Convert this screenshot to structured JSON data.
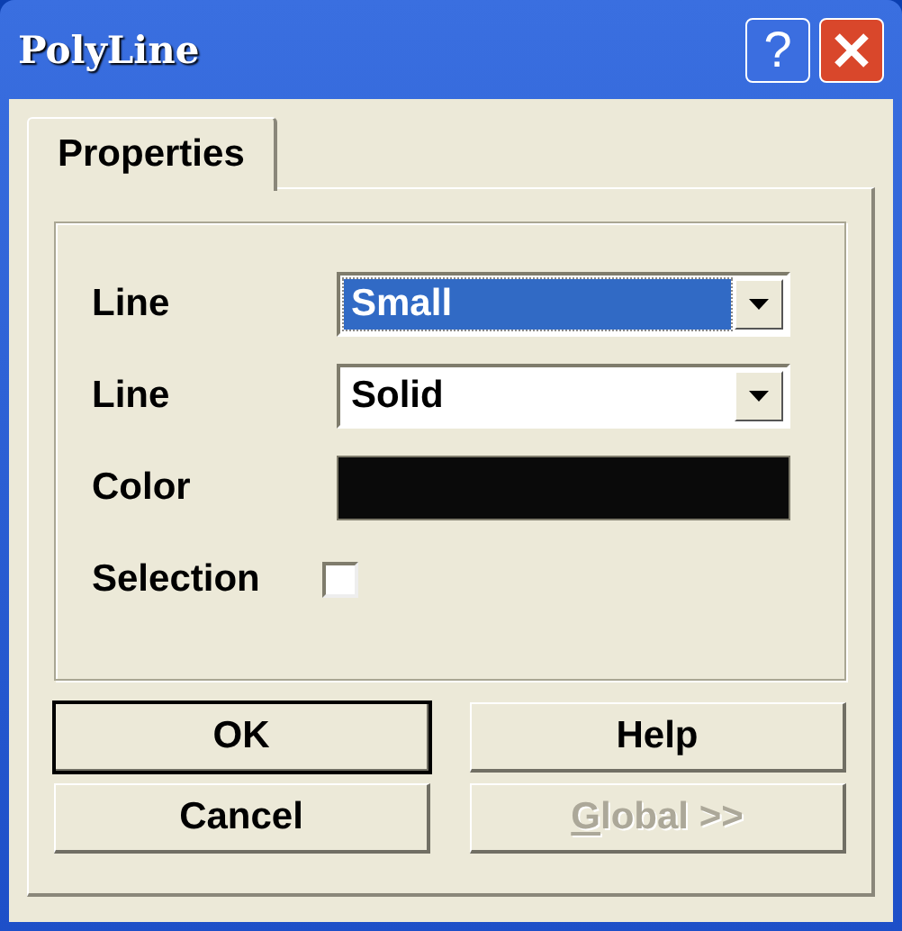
{
  "window": {
    "title": "PolyLine"
  },
  "title_buttons": [
    {
      "kind": "help",
      "label": "?"
    },
    {
      "kind": "close"
    }
  ],
  "tabs": [
    {
      "label": "Properties",
      "selected": true
    }
  ],
  "fields": [
    {
      "kind": "dropdown",
      "label": "Line",
      "value": "Small",
      "selected": true
    },
    {
      "kind": "dropdown",
      "label": "Line",
      "value": "Solid",
      "selected": false
    },
    {
      "kind": "color",
      "label": "Color",
      "color": "#0a0a0a"
    },
    {
      "kind": "checkbox",
      "label": "Selection",
      "checked": false
    }
  ],
  "buttons": [
    {
      "label": "OK",
      "default": true,
      "disabled": false
    },
    {
      "label": "Help",
      "default": false,
      "disabled": false
    },
    {
      "label": "Cancel",
      "default": false,
      "disabled": false
    },
    {
      "label": "Global >>",
      "default": false,
      "disabled": true,
      "mnemonic_underlined": true
    }
  ]
}
